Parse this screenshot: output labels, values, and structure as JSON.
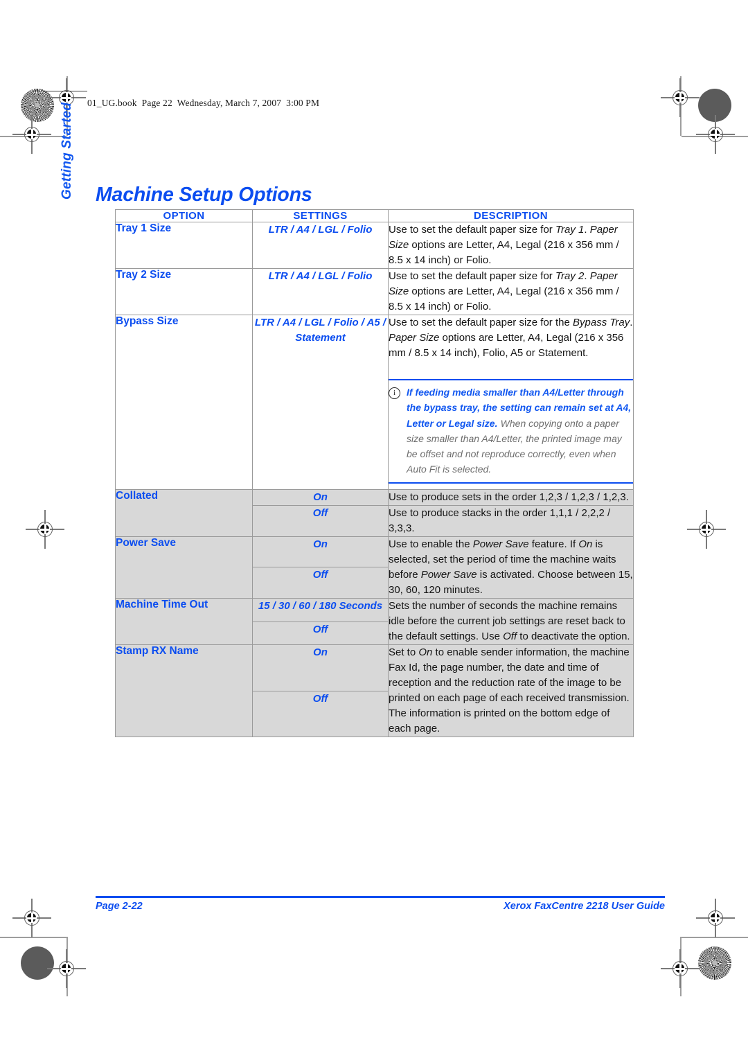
{
  "book_header": {
    "text": "01_UG.book  Page 22  Wednesday, March 7, 2007  3:00 PM"
  },
  "side_tab": {
    "label": "Getting Started"
  },
  "title": "Machine Setup Options",
  "table": {
    "headers": {
      "option": "OPTION",
      "settings": "SETTINGS",
      "description": "DESCRIPTION"
    },
    "rows": [
      {
        "option": "Tray 1 Size",
        "settings": "LTR / A4 / LGL / Folio",
        "description_html": "Use to set the default paper size for <em>Tray 1</em>. <em>Paper Size</em> options are Letter, A4, Legal (216 x 356 mm / 8.5 x 14 inch) or Folio."
      },
      {
        "option": "Tray 2 Size",
        "settings": "LTR / A4 / LGL / Folio",
        "description_html": "Use to set the default paper size for <em>Tray 2</em>. <em>Paper Size</em> options are Letter, A4, Legal (216 x 356 mm / 8.5 x 14 inch) or Folio."
      },
      {
        "option": "Bypass Size",
        "settings": "LTR / A4 / LGL / Folio / A5 / Statement",
        "description_html": "Use to set the default paper size for the <em>Bypass Tray</em>. <em>Paper Size</em> options are Letter, A4, Legal (216 x 356 mm / 8.5 x 14 inch), Folio, A5 or Statement."
      },
      {
        "option": "Collated",
        "settings_a": "On",
        "settings_b": "Off",
        "description_a": "Use to produce sets in the order 1,2,3 / 1,2,3 / 1,2,3.",
        "description_b": "Use to produce stacks in the order 1,1,1 / 2,2,2 / 3,3,3."
      },
      {
        "option": "Power Save",
        "settings_a": "On",
        "settings_b": "Off",
        "description_html": "Use to enable the <em>Power Save</em> feature. If <em>On</em> is selected, set the period of time the machine waits before <em>Power Save</em> is activated. Choose between 15, 30, 60, 120 minutes."
      },
      {
        "option": "Machine Time Out",
        "settings_a": "15 / 30 / 60 / 180 Seconds",
        "settings_b": "Off",
        "description_html": "Sets the number of seconds the machine remains idle before the current job settings are reset back to the default settings. Use <em>Off</em> to deactivate the option."
      },
      {
        "option": "Stamp RX Name",
        "settings_a": "On",
        "settings_b": "Off",
        "description_html": "Set to <em>On</em> to enable sender information, the machine Fax Id, the page number, the date and time of reception and the reduction rate of the image to be printed on each page of each received transmission. The information is printed on the bottom edge of each page."
      }
    ]
  },
  "note": {
    "icon": "info-icon",
    "primary": "If feeding media smaller than A4/Letter through the bypass tray, the setting can remain set at A4, Letter or Legal size.",
    "secondary": "When copying onto a paper size smaller than A4/Letter, the printed image may be offset and not reproduce correctly, even when Auto Fit is selected."
  },
  "footer": {
    "page": "Page 2-22",
    "guide": "Xerox FaxCentre 2218 User Guide"
  },
  "colors": {
    "accent_blue": "#0b4df0",
    "bright_blue": "#1157f0",
    "shaded_row": "#d8d8d8",
    "note_gray": "#6e6e6e",
    "table_border": "#9a9a9a"
  }
}
